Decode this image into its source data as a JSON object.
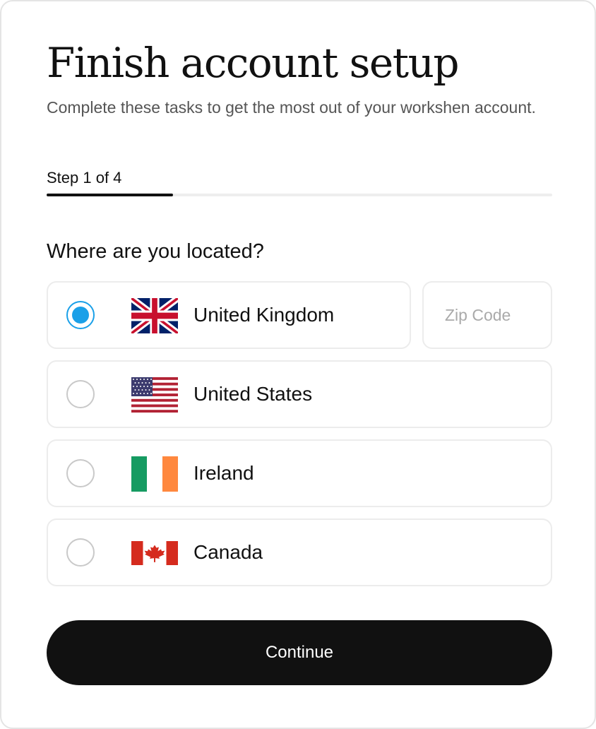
{
  "header": {
    "title": "Finish account setup",
    "subtitle": "Complete these tasks to get the most out of your workshen account."
  },
  "progress": {
    "label": "Step 1 of 4",
    "current_step": 1,
    "total_steps": 4,
    "fraction": 0.25
  },
  "location": {
    "question": "Where are you located?",
    "selected": "United Kingdom",
    "options": [
      {
        "label": "United Kingdom",
        "flag": "uk-flag-icon",
        "selected": true
      },
      {
        "label": "United States",
        "flag": "us-flag-icon",
        "selected": false
      },
      {
        "label": "Ireland",
        "flag": "ireland-flag-icon",
        "selected": false
      },
      {
        "label": "Canada",
        "flag": "canada-flag-icon",
        "selected": false
      }
    ],
    "zip": {
      "value": "",
      "placeholder": "Zip Code"
    }
  },
  "actions": {
    "continue_label": "Continue"
  },
  "colors": {
    "accent": "#1aa0e8",
    "primary_button": "#111111",
    "border": "#ececec",
    "uk_blue": "#012169",
    "uk_red": "#C8102E",
    "us_red": "#B22234",
    "us_blue": "#3C3B6E",
    "ireland_green": "#169B62",
    "ireland_orange": "#FF883E",
    "canada_red": "#D52B1E"
  }
}
